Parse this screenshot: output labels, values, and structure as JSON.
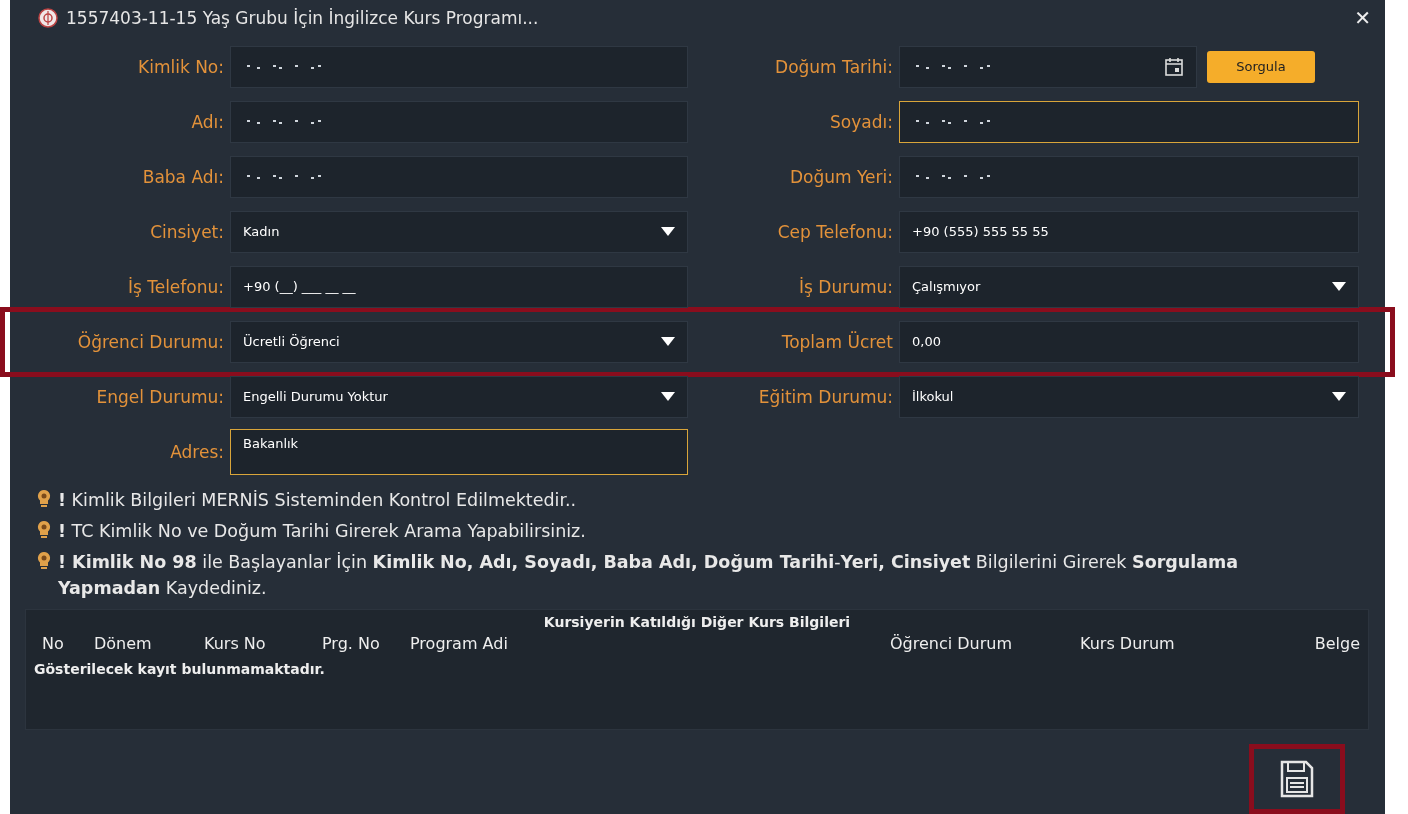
{
  "window": {
    "title": "1557403-11-15 Yaş Grubu İçin İngilizce Kurs Programı...",
    "close": "✕"
  },
  "form_rows": [
    {
      "highlighted": false,
      "left": {
        "label": "Kimlik No:",
        "kind": "text",
        "redacted": true,
        "focused": false
      },
      "right": {
        "label": "Doğum Tarihi:",
        "kind": "date",
        "redacted": true,
        "focused": false,
        "button": "Sorgula"
      }
    },
    {
      "highlighted": false,
      "left": {
        "label": "Adı:",
        "kind": "text",
        "redacted": true,
        "focused": false
      },
      "right": {
        "label": "Soyadı:",
        "kind": "text",
        "redacted": true,
        "focused": true
      }
    },
    {
      "highlighted": false,
      "left": {
        "label": "Baba Adı:",
        "kind": "text",
        "redacted": true,
        "focused": false
      },
      "right": {
        "label": "Doğum Yeri:",
        "kind": "text",
        "redacted": true,
        "focused": false
      }
    },
    {
      "highlighted": false,
      "left": {
        "label": "Cinsiyet:",
        "kind": "select",
        "value": "Kadın",
        "focused": false
      },
      "right": {
        "label": "Cep Telefonu:",
        "kind": "text",
        "value": "+90 (555) 555 55 55",
        "focused": false
      }
    },
    {
      "highlighted": false,
      "left": {
        "label": "İş Telefonu:",
        "kind": "text",
        "value": "+90 (__) ___ __ __",
        "focused": false
      },
      "right": {
        "label": "İş Durumu:",
        "kind": "select",
        "value": "Çalışmıyor",
        "focused": false
      }
    },
    {
      "highlighted": true,
      "left": {
        "label": "Öğrenci Durumu:",
        "kind": "select",
        "value": "Ücretli Öğrenci",
        "focused": false
      },
      "right": {
        "label": "Toplam Ücret",
        "kind": "text",
        "value": "0,00",
        "focused": false
      }
    },
    {
      "highlighted": false,
      "left": {
        "label": "Engel Durumu:",
        "kind": "select",
        "value": "Engelli Durumu Yoktur",
        "focused": false
      },
      "right": {
        "label": "Eğitim Durumu:",
        "kind": "select",
        "value": "İlkokul",
        "focused": false
      }
    },
    {
      "highlighted": false,
      "left": {
        "label": "Adres:",
        "kind": "textarea",
        "value": "Bakanlık",
        "focused": true
      }
    }
  ],
  "notes": [
    "**!** Kimlik Bilgileri MERNİS Sisteminden Kontrol Edilmektedir..",
    "**!** TC Kimlik No ve Doğum Tarihi Girerek Arama Yapabilirsiniz.",
    "**! Kimlik No 98** ile Başlayanlar İçin **Kimlik No, Adı, Soyadı, Baba Adı, Doğum Tarihi**-**Yeri, Cinsiyet** Bilgilerini Girerek **Sorgulama Yapmadan** Kaydediniz."
  ],
  "table": {
    "title": "Kursiyerin Katıldığı Diğer Kurs Bilgileri",
    "columns": [
      "No",
      "Dönem",
      "Kurs No",
      "Prg. No",
      "Program Adi",
      "Öğrenci Durum",
      "Kurs Durum",
      "Belge"
    ],
    "empty_message": "Gösterilecek kayıt bulunmamaktadır."
  },
  "save_button": {
    "highlighted": true
  }
}
